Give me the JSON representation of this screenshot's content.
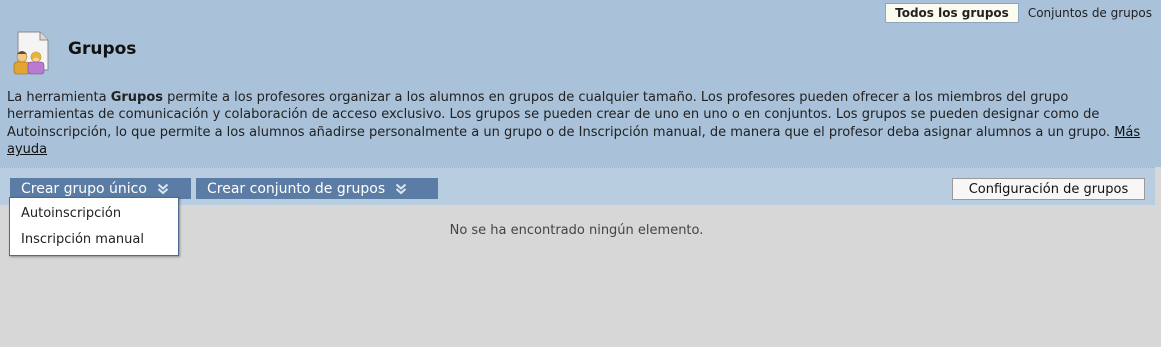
{
  "tabs": [
    {
      "label": "Todos los grupos",
      "active": true
    },
    {
      "label": "Conjuntos de grupos",
      "active": false
    }
  ],
  "page": {
    "title": "Grupos",
    "icon": "groups-icon"
  },
  "description": {
    "part1": "La herramienta ",
    "bold": "Grupos",
    "part2": " permite a los profesores organizar a los alumnos en grupos de cualquier tamaño. Los profesores pueden ofrecer a los miembros del grupo herramientas de comunicación y colaboración de acceso exclusivo. Los grupos se pueden crear de uno en uno o en conjuntos. Los grupos se pueden designar como de Autoinscripción, lo que permite a los alumnos añadirse personalmente a un grupo o de Inscripción manual, de manera que el profesor deba asignar alumnos a un grupo. ",
    "link": "Más ayuda"
  },
  "actions": {
    "create_single": "Crear grupo único",
    "create_set": "Crear conjunto de grupos",
    "settings": "Configuración de grupos"
  },
  "dropdown": {
    "items": [
      "Autoinscripción",
      "Inscripción manual"
    ]
  },
  "empty_message": "No se ha encontrado ningún elemento.",
  "colors": {
    "header_bg": "#a9c1d9",
    "action_bar_bg": "#b9cde0",
    "button_bg": "#5b7da5",
    "content_bg": "#d7d7d7"
  }
}
